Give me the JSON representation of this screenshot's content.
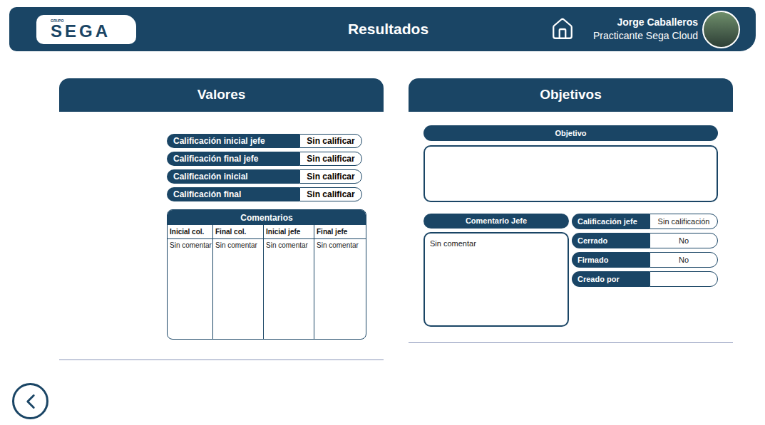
{
  "header": {
    "logo": {
      "small": "GRUPO",
      "main": "SEGA"
    },
    "title": "Resultados",
    "user": {
      "name": "Jorge Caballeros",
      "role": "Practicante Sega Cloud"
    }
  },
  "values_panel": {
    "title": "Valores",
    "ratings": [
      {
        "label": "Calificación inicial jefe",
        "value": "Sin calificar"
      },
      {
        "label": "Calificación final jefe",
        "value": "Sin calificar"
      },
      {
        "label": "Calificación inicial",
        "value": "Sin calificar"
      },
      {
        "label": "Calificación final",
        "value": "Sin calificar"
      }
    ],
    "comments": {
      "title": "Comentarios",
      "columns": [
        {
          "label": "Inicial col.",
          "value": "Sin comentar"
        },
        {
          "label": "Final col.",
          "value": "Sin comentar"
        },
        {
          "label": "Inicial jefe",
          "value": "Sin comentar"
        },
        {
          "label": "Final jefe",
          "value": "Sin comentar"
        }
      ]
    }
  },
  "objectives_panel": {
    "title": "Objetivos",
    "objective": {
      "label": "Objetivo",
      "value": ""
    },
    "boss_comment": {
      "label": "Comentario Jefe",
      "value": "Sin comentar"
    },
    "fields": [
      {
        "label": "Calificación jefe",
        "value": "Sin calificación"
      },
      {
        "label": "Cerrado",
        "value": "No"
      },
      {
        "label": "Firmado",
        "value": "No"
      },
      {
        "label": "Creado por",
        "value": ""
      }
    ]
  }
}
